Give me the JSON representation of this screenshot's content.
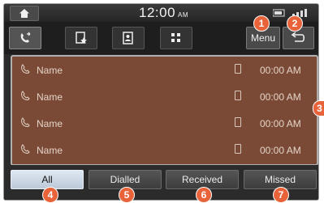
{
  "status_bar": {
    "time": "12:00",
    "ampm": "AM"
  },
  "toolbar": {
    "menu_label": "Menu"
  },
  "call_list": [
    {
      "name": "Name",
      "time": "00:00 AM"
    },
    {
      "name": "Name",
      "time": "00:00 AM"
    },
    {
      "name": "Name",
      "time": "00:00 AM"
    },
    {
      "name": "Name",
      "time": "00:00 AM"
    }
  ],
  "filters": [
    {
      "label": "All",
      "selected": true
    },
    {
      "label": "Dialled",
      "selected": false
    },
    {
      "label": "Received",
      "selected": false
    },
    {
      "label": "Missed",
      "selected": false
    }
  ],
  "callouts": [
    "1",
    "2",
    "3",
    "4",
    "5",
    "6",
    "7"
  ],
  "colors": {
    "list_bg": "#7a4a36",
    "callout": "#e8633a",
    "active_filter": "#cfd9e5"
  },
  "icons": [
    "home-icon",
    "call-history-icon",
    "favorites-icon",
    "contacts-icon",
    "keypad-icon",
    "phone-icon",
    "device-icon",
    "back-icon"
  ]
}
